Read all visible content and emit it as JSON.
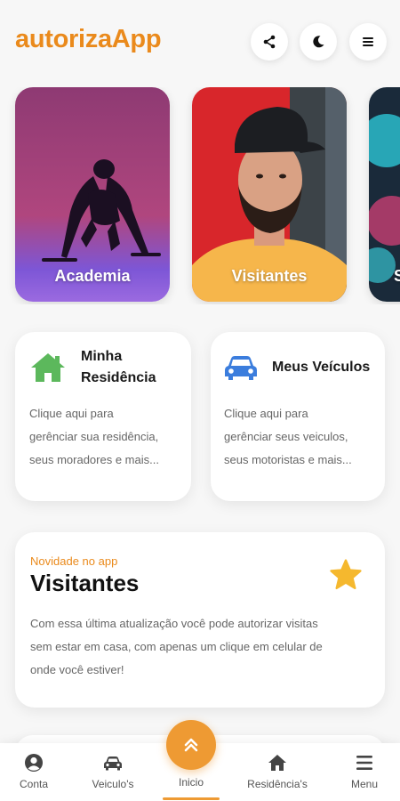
{
  "header": {
    "title": "autorizaApp",
    "buttons": [
      {
        "icon": "share-icon"
      },
      {
        "icon": "moon-icon"
      },
      {
        "icon": "menu-icon"
      }
    ]
  },
  "stories": [
    {
      "label": "Academia",
      "image": "athlete at starting position"
    },
    {
      "label": "Visitantes",
      "image": "bearded man in black cap"
    },
    {
      "label": "S",
      "image": "colorful neon"
    }
  ],
  "cards": {
    "residencia": {
      "icon": "house-icon",
      "title_line1": "Minha",
      "title_line2": "Residência",
      "desc_line1": "Clique aqui para",
      "desc_line2": "gerênciar sua residência,",
      "desc_line3": "seus moradores e mais..."
    },
    "veiculos": {
      "icon": "car-icon",
      "title": "Meus Veículos",
      "desc_line1": "Clique aqui para",
      "desc_line2": "gerênciar seus veiculos,",
      "desc_line3": "seus motoristas e mais..."
    }
  },
  "news": {
    "eyebrow": "Novidade no app",
    "title": "Visitantes",
    "icon": "star-icon",
    "text_line1": "Com essa última atualização você pode autorizar visitas",
    "text_line2": "sem estar em casa, com apenas um clique em celular de",
    "text_line3": "onde você estiver!"
  },
  "nav": {
    "items": [
      {
        "label": "Conta",
        "icon": "user-icon"
      },
      {
        "label": "Veiculo's",
        "icon": "car-icon"
      },
      {
        "label": "Inicio",
        "icon": "chevrons-up-icon"
      },
      {
        "label": "Residência's",
        "icon": "house-icon"
      },
      {
        "label": "Menu",
        "icon": "menu-icon"
      }
    ]
  },
  "colors": {
    "accent": "#ea8a1c",
    "house_green": "#5cb85c",
    "car_blue": "#3b7ddd",
    "star_yellow": "#f5b82e"
  }
}
